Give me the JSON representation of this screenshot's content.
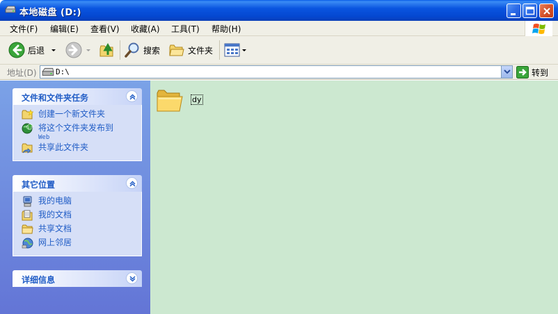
{
  "window": {
    "title": "本地磁盘 (D:)"
  },
  "menu": [
    "文件(F)",
    "编辑(E)",
    "查看(V)",
    "收藏(A)",
    "工具(T)",
    "帮助(H)"
  ],
  "toolbar": {
    "back_label": "后退",
    "search_label": "搜索",
    "folders_label": "文件夹"
  },
  "address": {
    "label": "地址(D)",
    "value": "D:\\",
    "go_label": "转到"
  },
  "panels": {
    "tasks": {
      "title": "文件和文件夹任务",
      "items": [
        {
          "label": "创建一个新文件夹",
          "icon": "new-folder-icon"
        },
        {
          "label": "将这个文件夹发布到",
          "sub": "Web",
          "icon": "publish-web-icon"
        },
        {
          "label": "共享此文件夹",
          "icon": "share-folder-icon"
        }
      ]
    },
    "places": {
      "title": "其它位置",
      "items": [
        {
          "label": "我的电脑",
          "icon": "my-computer-icon"
        },
        {
          "label": "我的文档",
          "icon": "my-documents-icon"
        },
        {
          "label": "共享文档",
          "icon": "shared-documents-icon"
        },
        {
          "label": "网上邻居",
          "icon": "network-places-icon"
        }
      ]
    },
    "details": {
      "title": "详细信息"
    }
  },
  "files": [
    {
      "name": "dy",
      "type": "folder"
    }
  ],
  "colors": {
    "titlebar": "#0a55e0",
    "task_link": "#215dc6",
    "content_bg": "#cce8d0",
    "left_pane": "#7ba2e7"
  }
}
